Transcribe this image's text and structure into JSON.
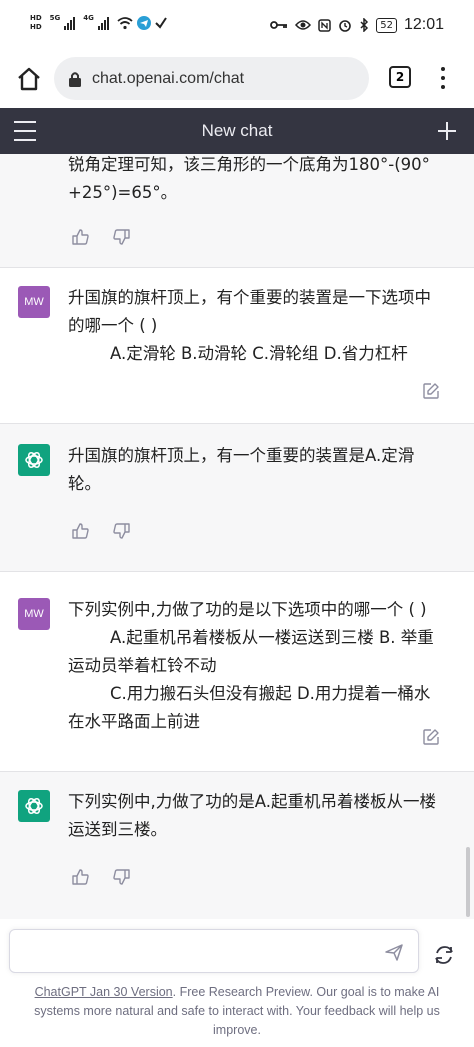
{
  "status_bar": {
    "hd1": "HD",
    "hd2": "HD",
    "net1": "5G",
    "net2": "4G",
    "battery": "52",
    "time": "12:01"
  },
  "browser": {
    "url": "chat.openai.com/chat",
    "tab_count": "2"
  },
  "nav": {
    "title": "New chat"
  },
  "messages": [
    {
      "role": "assistant",
      "text": "锐角定理可知，该三角形的一个底角为180°-(90°+25°)=65°。"
    },
    {
      "role": "user",
      "avatar": "MW",
      "text": "升国旗的旗杆顶上，有个重要的装置是一下选项中的哪一个 ( )\n        A.定滑轮 B.动滑轮 C.滑轮组 D.省力杠杆"
    },
    {
      "role": "assistant",
      "text": "升国旗的旗杆顶上，有一个重要的装置是A.定滑轮。"
    },
    {
      "role": "user",
      "avatar": "MW",
      "text": "下列实例中,力做了功的是以下选项中的哪一个 ( )\n        A.起重机吊着楼板从一楼运送到三楼 B. 举重运动员举着杠铃不动\n        C.用力搬石头但没有搬起 D.用力提着一桶水在水平路面上前进"
    },
    {
      "role": "assistant",
      "text": "下列实例中,力做了功的是A.起重机吊着楼板从一楼运送到三楼。"
    }
  ],
  "footer": {
    "link": "ChatGPT Jan 30 Version",
    "text": ". Free Research Preview. Our goal is to make AI systems more natural and safe to interact with. Your feedback will help us improve."
  },
  "colors": {
    "nav_bg": "#343541",
    "ai_bg": "#f7f7f8",
    "user_avatar": "#9b59b6",
    "gpt_avatar": "#10a37f"
  }
}
